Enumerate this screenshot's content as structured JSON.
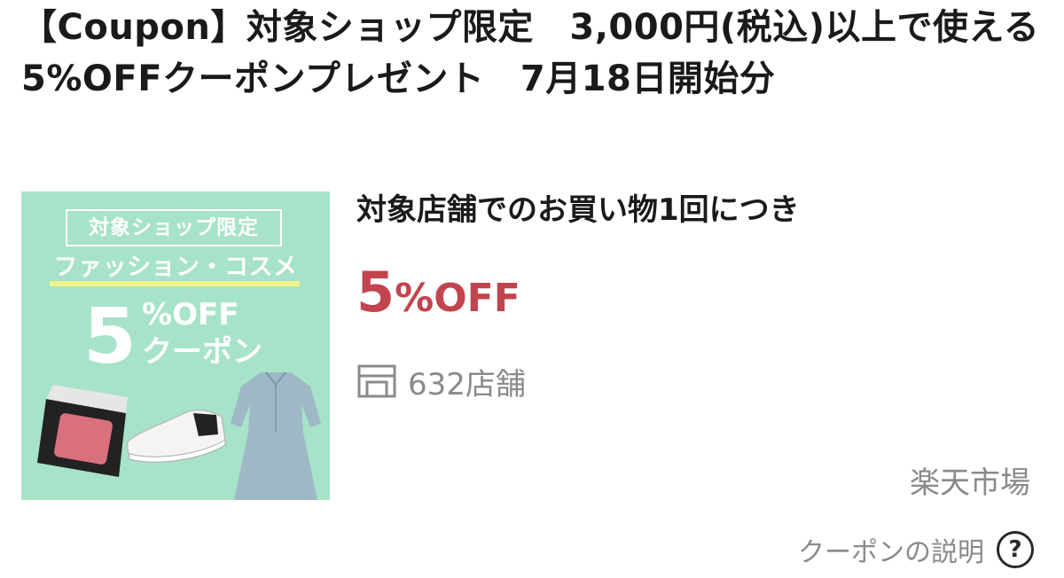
{
  "coupon": {
    "title": "【Coupon】対象ショップ限定　3,000円(税込)以上で使える5%OFFクーポンプレゼント　7月18日開始分",
    "banner": {
      "shop_label": "対象ショップ限定",
      "category_label": "ファッション・コスメ",
      "discount_number": "5",
      "discount_percent": "%OFF",
      "coupon_word": "クーポン"
    },
    "condition": "対象店舗でのお買い物1回につき",
    "discount_number": "5",
    "discount_suffix": "%OFF",
    "shop_count": "632店舗",
    "shop_icon": "store-icon",
    "marketplace": "楽天市場",
    "help_label": "クーポンの説明",
    "help_icon": "question-circle-icon",
    "colors": {
      "discount": "#c2444e",
      "banner_bg": "#a6e3c9",
      "muted_text": "#8a8a8a"
    }
  }
}
